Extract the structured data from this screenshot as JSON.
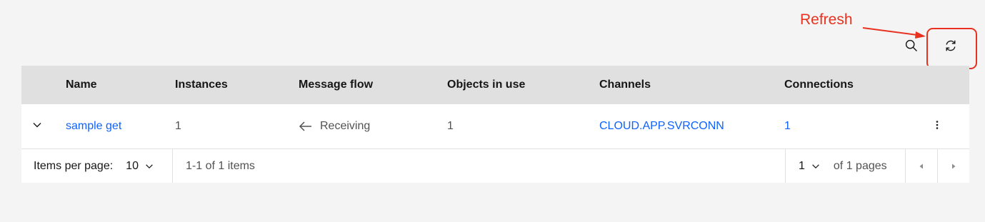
{
  "annotation": {
    "label": "Refresh",
    "color": "#e8321f"
  },
  "toolbar": {
    "search_icon": "search-icon",
    "refresh_icon": "refresh-icon"
  },
  "table": {
    "columns": [
      "Name",
      "Instances",
      "Message flow",
      "Objects in use",
      "Channels",
      "Connections"
    ],
    "rows": [
      {
        "name": "sample get",
        "instances": "1",
        "message_flow": "Receiving",
        "objects_in_use": "1",
        "channels": "CLOUD.APP.SVRCONN",
        "connections": "1"
      }
    ]
  },
  "pagination": {
    "items_per_page_label": "Items per page:",
    "items_per_page_value": "10",
    "items_range": "1-1 of 1 items",
    "current_page": "1",
    "of_pages": "of 1 pages"
  },
  "colors": {
    "link": "#0f62fe",
    "header_bg": "#e0e0e0",
    "page_bg": "#f4f4f4"
  }
}
